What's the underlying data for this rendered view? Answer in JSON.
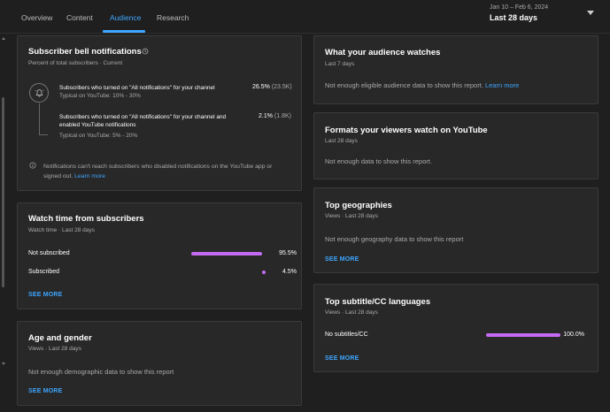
{
  "tabs": [
    {
      "label": "Overview"
    },
    {
      "label": "Content"
    },
    {
      "label": "Audience"
    },
    {
      "label": "Research"
    }
  ],
  "date_picker": {
    "range": "Jan 10 – Feb 6, 2024",
    "label": "Last 28 days"
  },
  "bell": {
    "title": "Subscriber bell notifications",
    "subtitle": "Percent of total subscribers · Current",
    "rows": [
      {
        "title": "Subscribers who turned on \"All notifications\" for your channel",
        "typical": "Typical on YouTube: 10% - 30%",
        "pct": "26.5%",
        "abs": "(23.5K)"
      },
      {
        "title": "Subscribers who turned on \"All notifications\" for your channel and enabled YouTube notifications",
        "typical": "Typical on YouTube: 5% - 20%",
        "pct": "2.1%",
        "abs": "(1.8K)"
      }
    ],
    "info": "Notifications can't reach subscribers who disabled notifications on the YouTube app or signed out.",
    "info_link": "Learn more"
  },
  "watch_time": {
    "title": "Watch time from subscribers",
    "subtitle": "Watch time · Last 28 days",
    "rows": [
      {
        "label": "Not subscribed",
        "value": "95.5%",
        "fraction": 0.955
      },
      {
        "label": "Subscribed",
        "value": "4.5%",
        "fraction": 0.045
      }
    ],
    "see_more": "SEE MORE"
  },
  "age_gender": {
    "title": "Age and gender",
    "subtitle": "Views · Last 28 days",
    "message": "Not enough demographic data to show this report",
    "see_more": "SEE MORE"
  },
  "audience_watches": {
    "title": "What your audience watches",
    "subtitle": "Last 7 days",
    "message": "Not enough eligible audience data to show this report.",
    "link": "Learn more"
  },
  "formats": {
    "title": "Formats your viewers watch on YouTube",
    "subtitle": "Last 28 days",
    "message": "Not enough data to show this report."
  },
  "geographies": {
    "title": "Top geographies",
    "subtitle": "Views · Last 28 days",
    "message": "Not enough geography data to show this report",
    "see_more": "SEE MORE"
  },
  "subtitles": {
    "title": "Top subtitle/CC languages",
    "subtitle": "Views · Last 28 days",
    "rows": [
      {
        "label": "No subtitles/CC",
        "value": "100.0%",
        "fraction": 1.0
      }
    ],
    "see_more": "SEE MORE"
  },
  "colors": {
    "accent": "#3ea6ff",
    "bar": "#c36bf2",
    "card": "#282828",
    "background": "#1f1f1f"
  }
}
